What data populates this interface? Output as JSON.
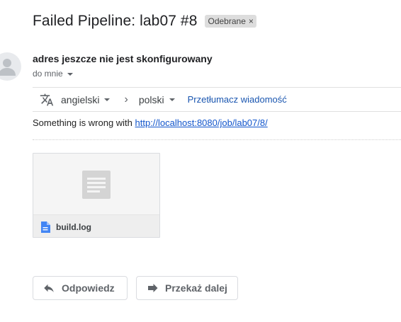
{
  "email": {
    "subject": "Failed Pipeline: lab07 #8",
    "label": "Odebrane",
    "label_remove": "×",
    "sender": "adres jeszcze nie jest skonfigurowany",
    "recipient": "do mnie"
  },
  "translate_bar": {
    "source_language": "angielski",
    "arrow": "›",
    "target_language": "polski",
    "translate_message": "Przetłumacz wiadomość"
  },
  "body": {
    "text": "Something is wrong with ",
    "link": "http://localhost:8080/job/lab07/8/"
  },
  "attachment": {
    "file_name": "build.log",
    "icon": "document-icon"
  },
  "actions": {
    "reply": "Odpowiedz",
    "forward": "Przekaż dalej"
  },
  "colors": {
    "link": "#1155cc",
    "doc_icon": "#4285f4",
    "label_bg": "#dddddd"
  }
}
